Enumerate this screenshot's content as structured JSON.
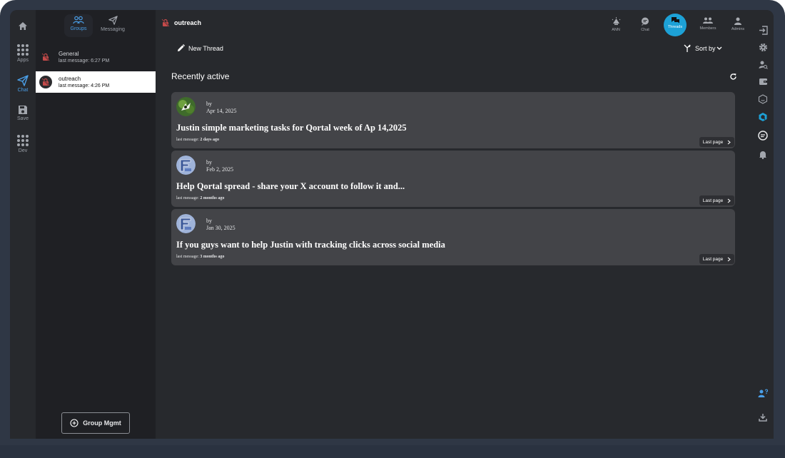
{
  "colors": {
    "accent_blue": "#4a9fe8",
    "threads_active": "#1da1d6",
    "card_bg": "#434448",
    "screen_bg": "#27292d",
    "sidebar_bg": "#1f2024",
    "group_icon_red": "#c54a4a"
  },
  "appnav": {
    "home_icon": "home-icon",
    "items": [
      {
        "label": "Apps",
        "icon": "grid-icon"
      },
      {
        "label": "Chat",
        "icon": "send-icon"
      },
      {
        "label": "Save",
        "icon": "save-icon"
      },
      {
        "label": "Dev",
        "icon": "grid-icon"
      }
    ]
  },
  "sidebar": {
    "tabs": [
      {
        "label": "Groups",
        "icon": "groups-icon"
      },
      {
        "label": "Messaging",
        "icon": "send-icon"
      }
    ],
    "groups": [
      {
        "name": "General",
        "last": "last message: 6:27 PM"
      },
      {
        "name": "outreach",
        "last": "last message: 4:26 PM"
      }
    ],
    "group_mgmt": "Group Mgmt"
  },
  "header": {
    "group_name": "outreach",
    "tabs": [
      {
        "label": "ANN",
        "icon": "announcement-icon"
      },
      {
        "label": "Chat",
        "icon": "chat-icon"
      },
      {
        "label": "Threads",
        "icon": "threads-icon"
      },
      {
        "label": "Members",
        "icon": "members-icon"
      },
      {
        "label": "Admins",
        "icon": "admins-icon"
      }
    ]
  },
  "toolbar": {
    "new_thread": "New Thread",
    "sort_by": "Sort by"
  },
  "section_title": "Recently active",
  "threads": [
    {
      "by": "by",
      "date": "Apr 14, 2025",
      "title": "Justin simple marketing tasks for Qortal week of Ap 14,2025",
      "last_label": "last message:",
      "last_value": "2 days ago",
      "last_page": "Last page"
    },
    {
      "by": "by",
      "date": "Feb 2, 2025",
      "title": "Help Qortal spread - share your X account to follow it and...",
      "last_label": "last message:",
      "last_value": "2 months ago",
      "last_page": "Last page"
    },
    {
      "by": "by",
      "date": "Jan 30, 2025",
      "title": "If you guys want to help Justin with tracking clicks across social media",
      "last_label": "last message:",
      "last_value": "3 months ago",
      "last_page": "Last page"
    }
  ]
}
